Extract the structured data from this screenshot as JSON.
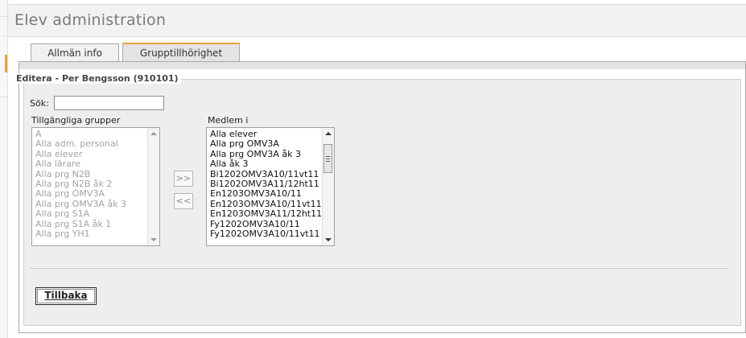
{
  "header": {
    "title": "Elev administration"
  },
  "tabs": [
    {
      "label": "Allmän info",
      "active": false
    },
    {
      "label": "Grupptillhörighet",
      "active": true
    }
  ],
  "form": {
    "legend": "Editera - Per Bengsson (910101)",
    "search_label": "Sök:",
    "search_value": "",
    "available_label": "Tillgängliga grupper",
    "member_label": "Medlem i",
    "available_groups": [
      "A",
      "Alla adm. personal",
      "Alla elever",
      "Alla lärare",
      "Alla prg N2B",
      "Alla prg N2B åk 2",
      "Alla prg OMV3A",
      "Alla prg OMV3A åk 3",
      "Alla prg S1A",
      "Alla prg S1A åk 1",
      "Alla prg YH1"
    ],
    "member_groups": [
      "Alla elever",
      "Alla prg OMV3A",
      "Alla prg OMV3A åk 3",
      "Alla åk 3",
      "Bi1202OMV3A10/11vt11",
      "Bi1202OMV3A11/12ht11",
      "En1203OMV3A10/11",
      "En1203OMV3A10/11vt11",
      "En1203OMV3A11/12ht11",
      "Fy1202OMV3A10/11",
      "Fy1202OMV3A10/11vt11"
    ],
    "add_button": ">>",
    "remove_button": "<<",
    "back_button": "Tillbaka"
  },
  "colors": {
    "tab_accent": "#e8a33a",
    "panel_bg": "#eeeeef",
    "disabled_text": "#a3a3a3"
  }
}
